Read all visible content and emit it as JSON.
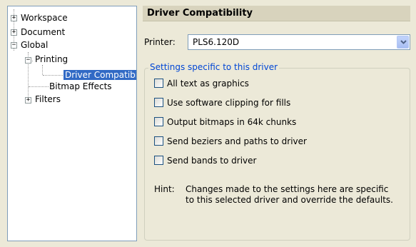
{
  "tree": {
    "items": [
      {
        "label": "Workspace",
        "expander": "+"
      },
      {
        "label": "Document",
        "expander": "+"
      },
      {
        "label": "Global",
        "expander": "−"
      },
      {
        "label": "Printing",
        "expander": "−"
      },
      {
        "label": "Driver Compatibility"
      },
      {
        "label": "Bitmap Effects"
      },
      {
        "label": "Filters",
        "expander": "+"
      }
    ]
  },
  "panel": {
    "title": "Driver Compatibility",
    "printer_label": "Printer:",
    "printer_value": "PLS6.120D",
    "group_label": "Settings specific to this driver",
    "options": [
      {
        "label": "All text as graphics",
        "checked": false
      },
      {
        "label": "Use software clipping for fills",
        "checked": false
      },
      {
        "label": "Output bitmaps in 64k chunks",
        "checked": false
      },
      {
        "label": "Send beziers and paths to driver",
        "checked": false
      },
      {
        "label": "Send bands to driver",
        "checked": false
      }
    ],
    "hint_label": "Hint:",
    "hint_text": "Changes made to the settings here are specific to this selected driver and override the defaults."
  },
  "colors": {
    "selection": "#316ac5",
    "group_label": "#0046d5",
    "header_bg": "#d8d3bd",
    "window_bg": "#ece9d8"
  }
}
